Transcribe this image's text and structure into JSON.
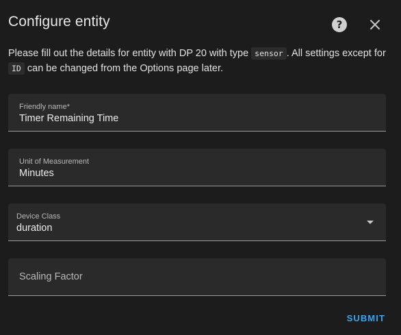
{
  "dialog": {
    "title": "Configure entity",
    "help_icon": "help-circle-icon",
    "close_icon": "close-icon",
    "description": {
      "part1": "Please fill out the details for entity with DP 20 with type ",
      "type_code": "sensor",
      "part2": ". All settings except for ",
      "id_code": "ID",
      "part3": " can be changed from the Options page later."
    },
    "fields": {
      "friendly_name": {
        "label": "Friendly name*",
        "value": "Timer Remaining Time"
      },
      "unit_of_measurement": {
        "label": "Unit of Measurement",
        "value": "Minutes"
      },
      "device_class": {
        "label": "Device Class",
        "value": "duration",
        "icon": "chevron-down-icon"
      },
      "scaling_factor": {
        "label": "Scaling Factor",
        "value": ""
      }
    },
    "submit_label": "SUBMIT",
    "colors": {
      "background": "#1c1c1c",
      "field_background": "#2a2a2a",
      "accent": "#3ba3ea"
    }
  }
}
